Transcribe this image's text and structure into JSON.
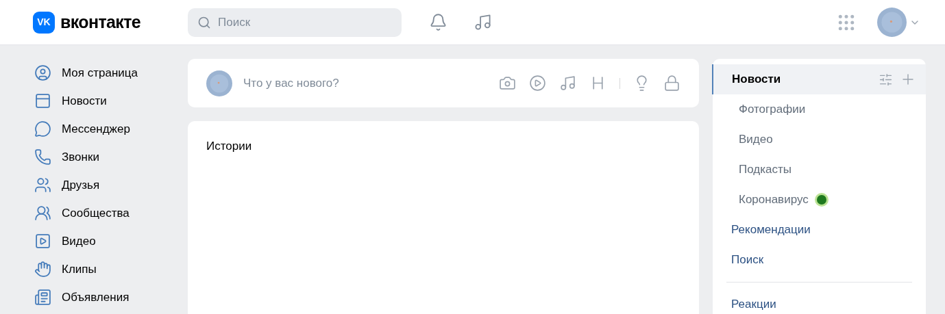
{
  "header": {
    "logo_mark": "VK",
    "logo_text": "вконтакте",
    "search": {
      "placeholder": "Поиск"
    }
  },
  "sidebar": {
    "items": [
      {
        "label": "Моя страница"
      },
      {
        "label": "Новости"
      },
      {
        "label": "Мессенджер"
      },
      {
        "label": "Звонки"
      },
      {
        "label": "Друзья"
      },
      {
        "label": "Сообщества"
      },
      {
        "label": "Видео"
      },
      {
        "label": "Клипы"
      },
      {
        "label": "Объявления"
      }
    ]
  },
  "composer": {
    "placeholder": "Что у вас нового?"
  },
  "stories": {
    "title": "Истории"
  },
  "news_menu": {
    "groups": [
      [
        {
          "label": "Новости",
          "kind": "main",
          "selected": true
        },
        {
          "label": "Фотографии",
          "kind": "sub",
          "selected": false
        },
        {
          "label": "Видео",
          "kind": "sub",
          "selected": false
        },
        {
          "label": "Подкасты",
          "kind": "sub",
          "selected": false
        },
        {
          "label": "Коронавирус",
          "kind": "sub",
          "selected": false,
          "badge": true
        },
        {
          "label": "Рекомендации",
          "kind": "main",
          "selected": false
        },
        {
          "label": "Поиск",
          "kind": "main",
          "selected": false
        }
      ],
      [
        {
          "label": "Реакции",
          "kind": "main",
          "selected": false
        }
      ]
    ]
  }
}
